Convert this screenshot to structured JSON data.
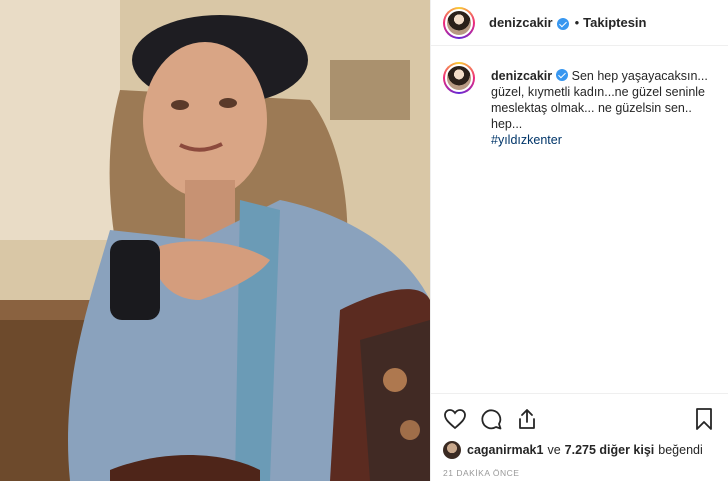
{
  "post": {
    "username": "denizcakir",
    "follow_status": "Takiptesin",
    "separator": "•",
    "caption_text": "Sen hep yaşayacaksın... güzel, kıymetli kadın...ne güzel seninle meslektaş olmak... ne güzelsin sen.. hep...",
    "hashtag": "#yıldızkenter"
  },
  "likes": {
    "first_liker": "caganirmak1",
    "connector": "ve",
    "others": "7.275 diğer kişi",
    "suffix": "beğendi"
  },
  "timestamp": "21 DAKİKA ÖNCE",
  "icons": {
    "like": "heart-icon",
    "comment": "comment-icon",
    "share": "share-icon",
    "save": "bookmark-icon",
    "verified": "verified-badge-icon"
  },
  "colors": {
    "verified": "#3897f0",
    "hashtag": "#003569",
    "timestamp": "#999999"
  }
}
